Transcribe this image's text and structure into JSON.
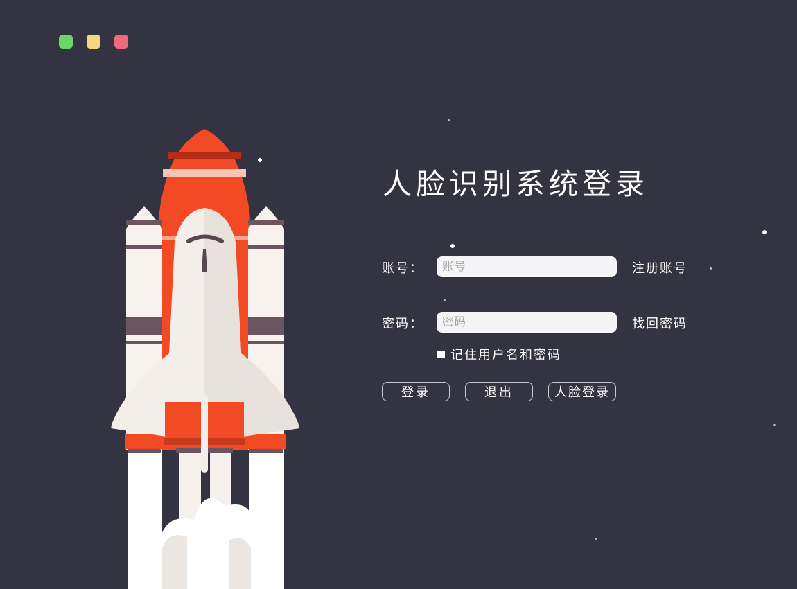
{
  "window_controls": {
    "maximize_color": "#6dd36a",
    "minimize_color": "#f5d77b",
    "close_color": "#f06a7c"
  },
  "title": "人脸识别系统登录",
  "account": {
    "label": "账号：",
    "placeholder": "账号",
    "value": "",
    "link": "注册账号"
  },
  "password": {
    "label": "密码：",
    "placeholder": "密码",
    "value": "",
    "link": "找回密码"
  },
  "remember": {
    "label": "记住用户名和密码",
    "checked": false
  },
  "buttons": {
    "login": "登录",
    "exit": "退出",
    "face_login": "人脸登录"
  },
  "colors": {
    "background": "#343342",
    "rocket_red": "#f24a25",
    "rocket_white": "#f3eee9",
    "rocket_stripe": "#6b5560"
  }
}
